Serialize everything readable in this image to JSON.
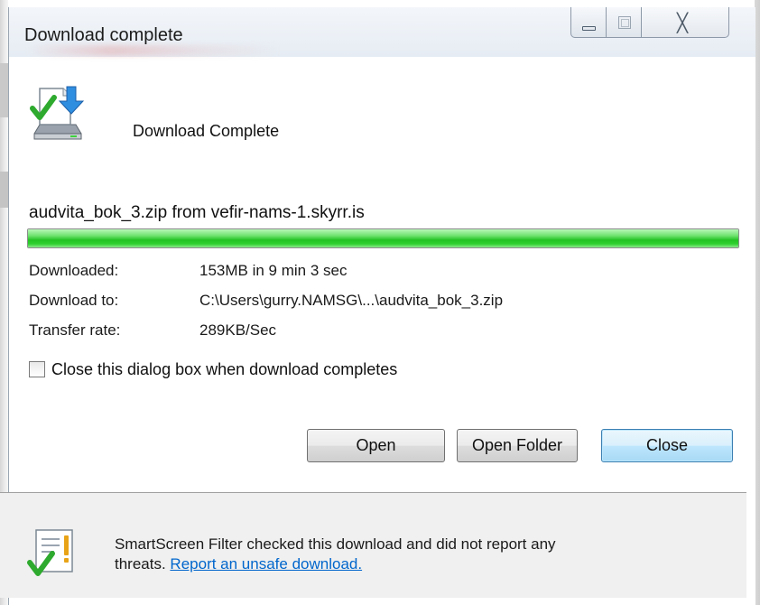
{
  "window": {
    "title": "Download complete",
    "controls": {
      "minimize": "minimize-icon",
      "maximize": "maximize-icon",
      "close_glyph": "╳"
    }
  },
  "header": {
    "icon": "download-complete-icon",
    "text": "Download Complete"
  },
  "download": {
    "file_line": "audvita_bok_3.zip from vefir-nams-1.skyrr.is",
    "progress_percent": 100,
    "progress_color": "#22c322",
    "details": [
      {
        "label": "Downloaded:",
        "value": "153MB in 9 min 3 sec"
      },
      {
        "label": "Download to:",
        "value": "C:\\Users\\gurry.NAMSG\\...\\audvita_bok_3.zip"
      },
      {
        "label": "Transfer rate:",
        "value": "289KB/Sec"
      }
    ]
  },
  "options": {
    "close_on_complete_label": "Close this dialog box when download completes",
    "close_on_complete_checked": false
  },
  "buttons": {
    "open": "Open",
    "open_folder": "Open Folder",
    "close": "Close"
  },
  "smartscreen": {
    "icon": "smartscreen-check-icon",
    "message_line1": "SmartScreen Filter checked this download and did not report any",
    "message_line2_prefix": "threats. ",
    "report_link": "Report an unsafe download."
  }
}
